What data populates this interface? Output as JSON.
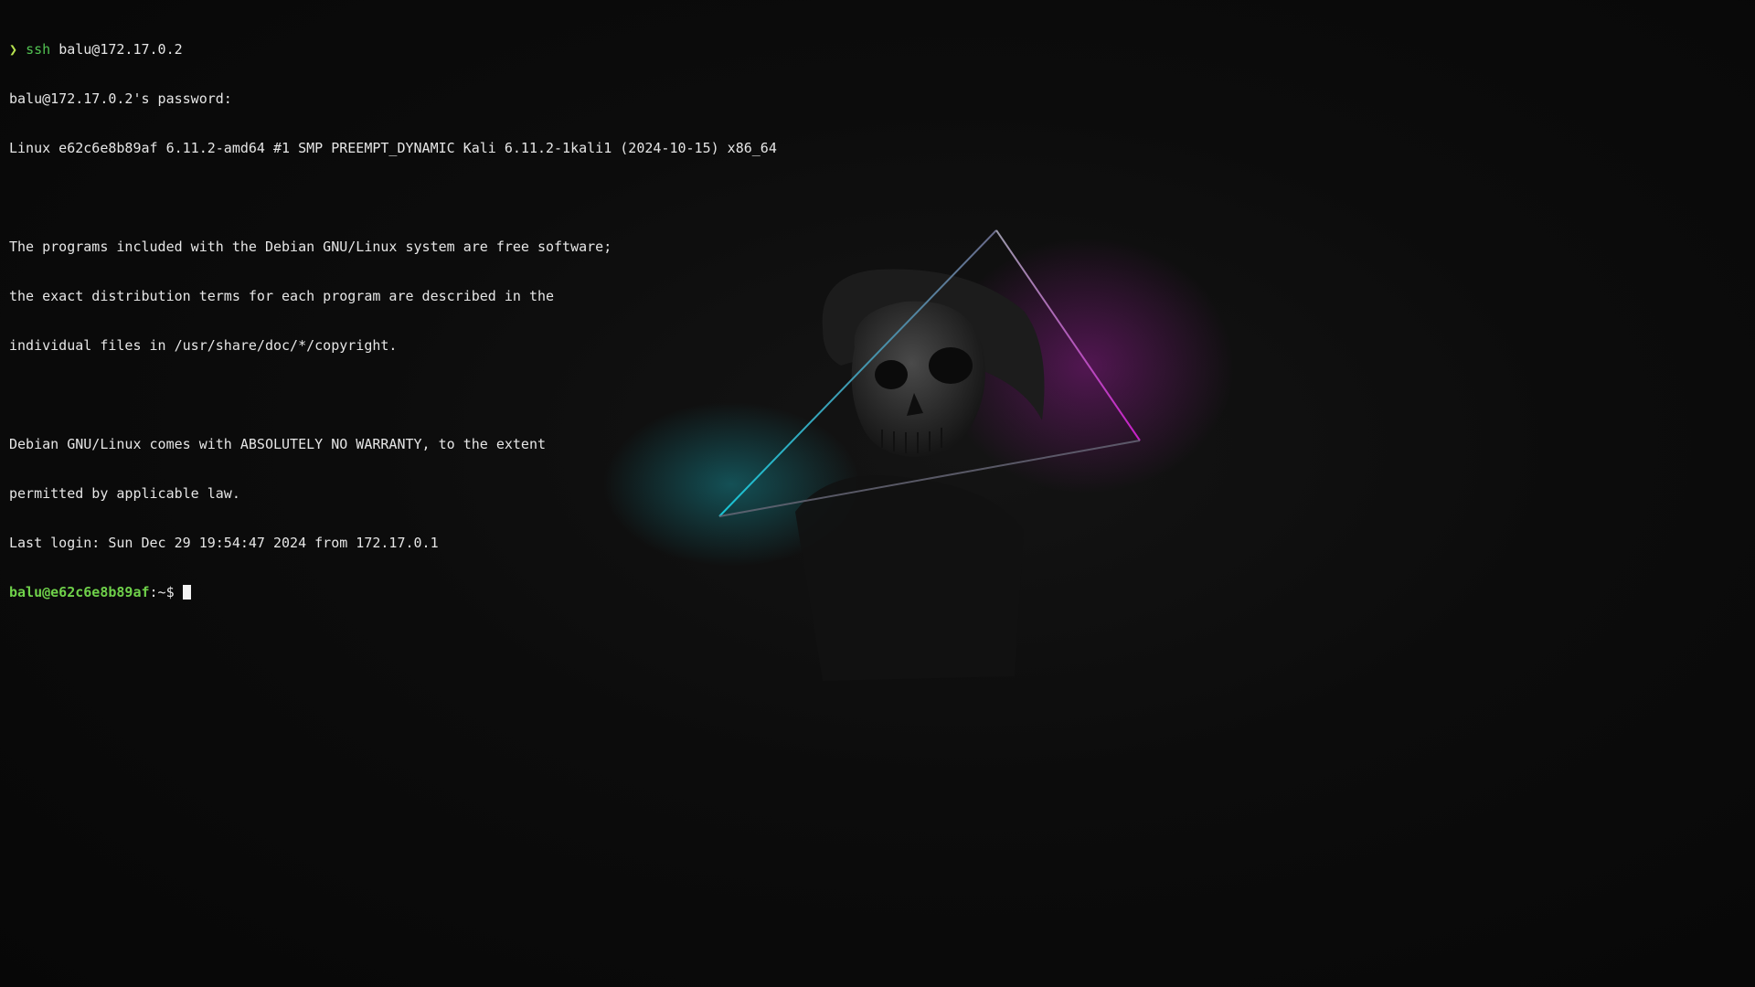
{
  "terminal": {
    "command_line": {
      "arrow": "❯",
      "command": "ssh",
      "args": "balu@172.17.0.2"
    },
    "lines": [
      "balu@172.17.0.2's password:",
      "Linux e62c6e8b89af 6.11.2-amd64 #1 SMP PREEMPT_DYNAMIC Kali 6.11.2-1kali1 (2024-10-15) x86_64",
      "",
      "The programs included with the Debian GNU/Linux system are free software;",
      "the exact distribution terms for each program are described in the",
      "individual files in /usr/share/doc/*/copyright.",
      "",
      "Debian GNU/Linux comes with ABSOLUTELY NO WARRANTY, to the extent",
      "permitted by applicable law.",
      "Last login: Sun Dec 29 19:54:47 2024 from 172.17.0.1"
    ],
    "prompt": {
      "user_host": "balu@e62c6e8b89af",
      "path_symbol": ":~$ "
    }
  },
  "wallpaper": {
    "subject": "skull-with-neon-triangle",
    "colors": {
      "neon_cyan": "#19c6d6",
      "neon_magenta": "#c81fc8",
      "triangle_edge": "#8a8a9a",
      "skull": "#3a3a3a"
    }
  }
}
